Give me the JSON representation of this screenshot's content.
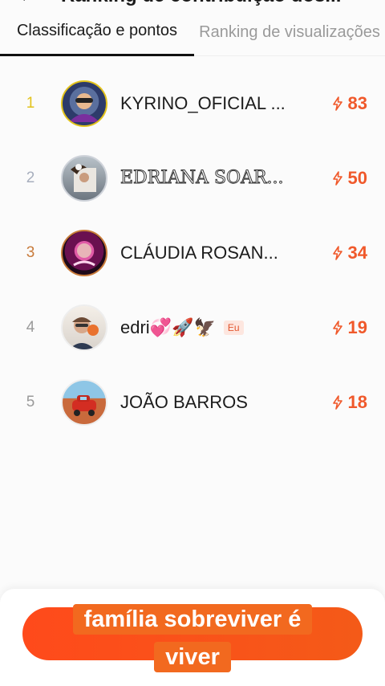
{
  "header": {
    "back_glyph": "←",
    "title": "Ranking de contribuição dos..."
  },
  "tabs": [
    {
      "label": "Classificação e pontos",
      "active": true
    },
    {
      "label": "Ranking de visualizações",
      "active": false
    }
  ],
  "ranking": [
    {
      "rank": "1",
      "name": "KYRINO_OFICIAL ...",
      "points": "83",
      "rank_color": "#e2c21b",
      "name_style": "normal",
      "badge": ""
    },
    {
      "rank": "2",
      "name": "EDRIANA SOAR...",
      "points": "50",
      "rank_color": "#a7aebd",
      "name_style": "outline",
      "badge": ""
    },
    {
      "rank": "3",
      "name": "CLÁUDIA ROSAN...",
      "points": "34",
      "rank_color": "#c87a3a",
      "name_style": "normal",
      "badge": ""
    },
    {
      "rank": "4",
      "name": "edri💞🚀🦅",
      "points": "19",
      "rank_color": "#9a9a9a",
      "name_style": "normal",
      "badge": "Eu"
    },
    {
      "rank": "5",
      "name": "JOÃO BARROS",
      "points": "18",
      "rank_color": "#9a9a9a",
      "name_style": "normal",
      "badge": ""
    }
  ],
  "caption": {
    "line1": "família sobreviver é",
    "line2": "viver"
  },
  "colors": {
    "accent": "#f0592b",
    "button": "#ff4a1b"
  }
}
